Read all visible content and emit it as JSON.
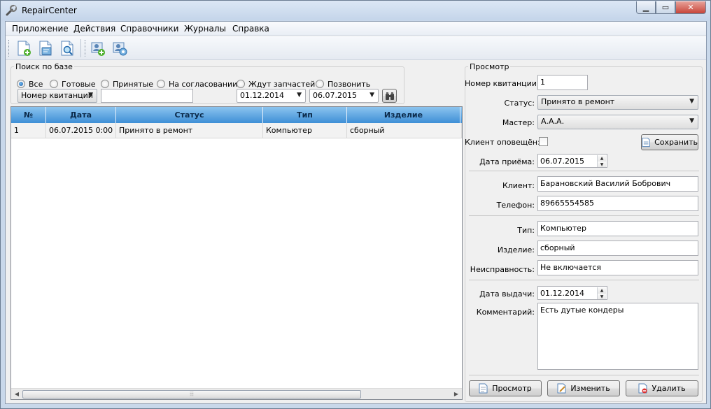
{
  "window": {
    "title": "RepairCenter",
    "minimize": "▁",
    "maximize": "▭",
    "close": "✕"
  },
  "menu": [
    {
      "label": "Приложение"
    },
    {
      "label": "Действия"
    },
    {
      "label": "Справочники"
    },
    {
      "label": "Журналы"
    },
    {
      "label": "Справка"
    }
  ],
  "search": {
    "group_title": "Поиск по базе",
    "filters": [
      {
        "label": "Все",
        "selected": true
      },
      {
        "label": "Готовые",
        "selected": false
      },
      {
        "label": "Принятые",
        "selected": false
      },
      {
        "label": "На согласовании",
        "selected": false
      },
      {
        "label": "Ждут запчастей",
        "selected": false
      },
      {
        "label": "Позвонить",
        "selected": false
      }
    ],
    "field_selected": "Номер квитанции",
    "query": "",
    "date_from": "01.12.2014",
    "date_to": "06.07.2015"
  },
  "table": {
    "columns": [
      "№",
      "Дата",
      "Статус",
      "Тип",
      "Изделие"
    ],
    "rows": [
      [
        "1",
        "06.07.2015 0:00",
        "Принято в ремонт",
        "Компьютер",
        "сборный"
      ]
    ]
  },
  "details": {
    "group_title": "Просмотр",
    "receipt_label": "Номер квитанции:",
    "receipt_value": "1",
    "status_label": "Статус:",
    "status_value": "Принято в ремонт",
    "master_label": "Мастер:",
    "master_value": "А.А.А.",
    "notified_label": "Клиент оповещён:",
    "notified_checked": false,
    "save_label": "Сохранить",
    "received_label": "Дата приёма:",
    "received_value": "06.07.2015",
    "client_label": "Клиент:",
    "client_value": "Барановский Василий Бобрович",
    "phone_label": "Телефон:",
    "phone_value": "89665554585",
    "type_label": "Тип:",
    "type_value": "Компьютер",
    "product_label": "Изделие:",
    "product_value": "сборный",
    "fault_label": "Неисправность:",
    "fault_value": "Не включается",
    "issued_label": "Дата выдачи:",
    "issued_value": "01.12.2014",
    "comment_label": "Комментарий:",
    "comment_value": "Есть дутые кондеры",
    "view_button": "Просмотр",
    "edit_button": "Изменить",
    "delete_button": "Удалить"
  },
  "colors": {
    "grid_header_top": "#8cc4ef",
    "grid_header_bottom": "#3e8fd6",
    "window_frame": "#c9d8ea"
  }
}
